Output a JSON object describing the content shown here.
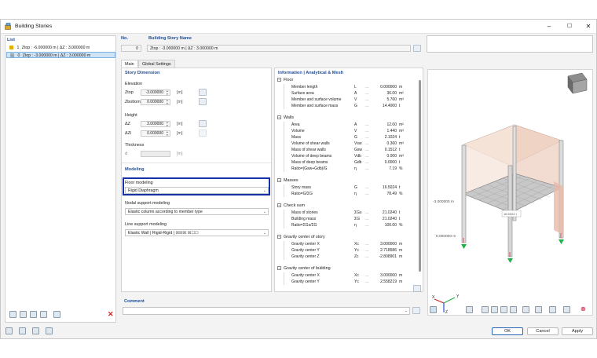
{
  "window": {
    "title": "Building Stories"
  },
  "list": {
    "header": "List",
    "items": [
      {
        "no": "1",
        "label": "Ztop : -6.000000 m | ΔZ : 3.000000 m",
        "color": "#e3b000"
      },
      {
        "no": "0",
        "label": "Ztop : -3.000000 m | ΔZ : 3.000000 m",
        "color": "#9aa7b5"
      }
    ]
  },
  "header": {
    "no_label": "No.",
    "no_value": "0",
    "name_label": "Building Story Name",
    "name_value": "Ztop : -3.000000 m | ΔZ : 3.000000 m"
  },
  "tabs": [
    "Main",
    "Global Settings"
  ],
  "story_dimension": {
    "title": "Story Dimension",
    "elevation_label": "Elevation",
    "ztop_label": "Ztop",
    "ztop_value": "-3.000000",
    "zbottom_label": "Zbottom",
    "zbottom_value": "0.000000",
    "height_label": "Height",
    "dz_label": "ΔZ",
    "dz_value": "3.000000",
    "dzi_label": "ΔZi",
    "dzi_value": "0.000000",
    "thickness_label": "Thickness",
    "d_label": "d",
    "unit_m": "[m]"
  },
  "modeling": {
    "title": "Modeling",
    "floor_label": "Floor modeling",
    "floor_value": "Rigid Diaphragm",
    "nodal_label": "Nodal support modeling",
    "nodal_value": "Elastic column according to member type",
    "line_label": "Line support modeling",
    "line_value": "Elastic Wall | Rigid-Rigid | ☒☒☒ ☒☐☐"
  },
  "comment": {
    "label": "Comment",
    "value": ""
  },
  "info": {
    "title": "Information | Analytical & Mesh",
    "groups": [
      {
        "name": "Floor",
        "rows": [
          {
            "label": "Member length",
            "sym": "L",
            "value": "0.000000",
            "unit": "m"
          },
          {
            "label": "Surface area",
            "sym": "A",
            "value": "36.00",
            "unit": "m²"
          },
          {
            "label": "Member and surface volume",
            "sym": "V",
            "value": "5.760",
            "unit": "m³"
          },
          {
            "label": "Member and surface mass",
            "sym": "G",
            "value": "14.4000",
            "unit": "t"
          }
        ]
      },
      {
        "name": "Walls",
        "rows": [
          {
            "label": "Area",
            "sym": "A",
            "value": "12.00",
            "unit": "m²"
          },
          {
            "label": "Volume",
            "sym": "V",
            "value": "1.440",
            "unit": "m³"
          },
          {
            "label": "Mass",
            "sym": "G",
            "value": "2.1024",
            "unit": "t"
          },
          {
            "label": "Volume of shear walls",
            "sym": "Vsw",
            "value": "0.360",
            "unit": "m³"
          },
          {
            "label": "Mass of shear walls",
            "sym": "Gsw",
            "value": "0.1512",
            "unit": "t"
          },
          {
            "label": "Volume of deep beams",
            "sym": "Vdb",
            "value": "0.000",
            "unit": "m³"
          },
          {
            "label": "Mass of deep beams",
            "sym": "Gdb",
            "value": "0.0000",
            "unit": "t"
          },
          {
            "label": "Ratio=(Gsw+Gdb)/G",
            "sym": "η",
            "value": "7.19",
            "unit": "%"
          }
        ]
      },
      {
        "name": "Masses",
        "rows": [
          {
            "label": "Story mass",
            "sym": "G",
            "value": "16.5024",
            "unit": "t"
          },
          {
            "label": "Ratio=G/ΣG",
            "sym": "η",
            "value": "78.49",
            "unit": "%"
          }
        ]
      },
      {
        "name": "Check sum",
        "rows": [
          {
            "label": "Mass of stories",
            "sym": "ΣGs",
            "value": "21.0240",
            "unit": "t"
          },
          {
            "label": "Building mass",
            "sym": "ΣG",
            "value": "21.0240",
            "unit": "t"
          },
          {
            "label": "Ratio=ΣGs/ΣG",
            "sym": "η",
            "value": "100.00",
            "unit": "%"
          }
        ]
      },
      {
        "name": "Gravity center of story",
        "rows": [
          {
            "label": "Gravity center X",
            "sym": "Xc",
            "value": "3.000000",
            "unit": "m"
          },
          {
            "label": "Gravity center Y",
            "sym": "Yc",
            "value": "2.718586",
            "unit": "m"
          },
          {
            "label": "Gravity center Z",
            "sym": "Zc",
            "value": "-2.808901",
            "unit": "m"
          }
        ]
      },
      {
        "name": "Gravity center of building",
        "rows": [
          {
            "label": "Gravity center X",
            "sym": "Xc",
            "value": "3.000000",
            "unit": "m"
          },
          {
            "label": "Gravity center Y",
            "sym": "Yc",
            "value": "2.558219",
            "unit": "m"
          }
        ]
      }
    ]
  },
  "viewport": {
    "label_top": "-3.000000 m",
    "label_bottom": "0.000000 m",
    "marker": "16.5024 t",
    "axis_y": "Y",
    "axis_x": "X",
    "axis_z": "Z"
  },
  "buttons": {
    "ok": "OK",
    "cancel": "Cancel",
    "apply": "Apply"
  },
  "colors": {
    "accent": "#1f4e99",
    "highlight": "#1530a8",
    "selected": "#cfe3f7",
    "support": "#22b24a"
  }
}
